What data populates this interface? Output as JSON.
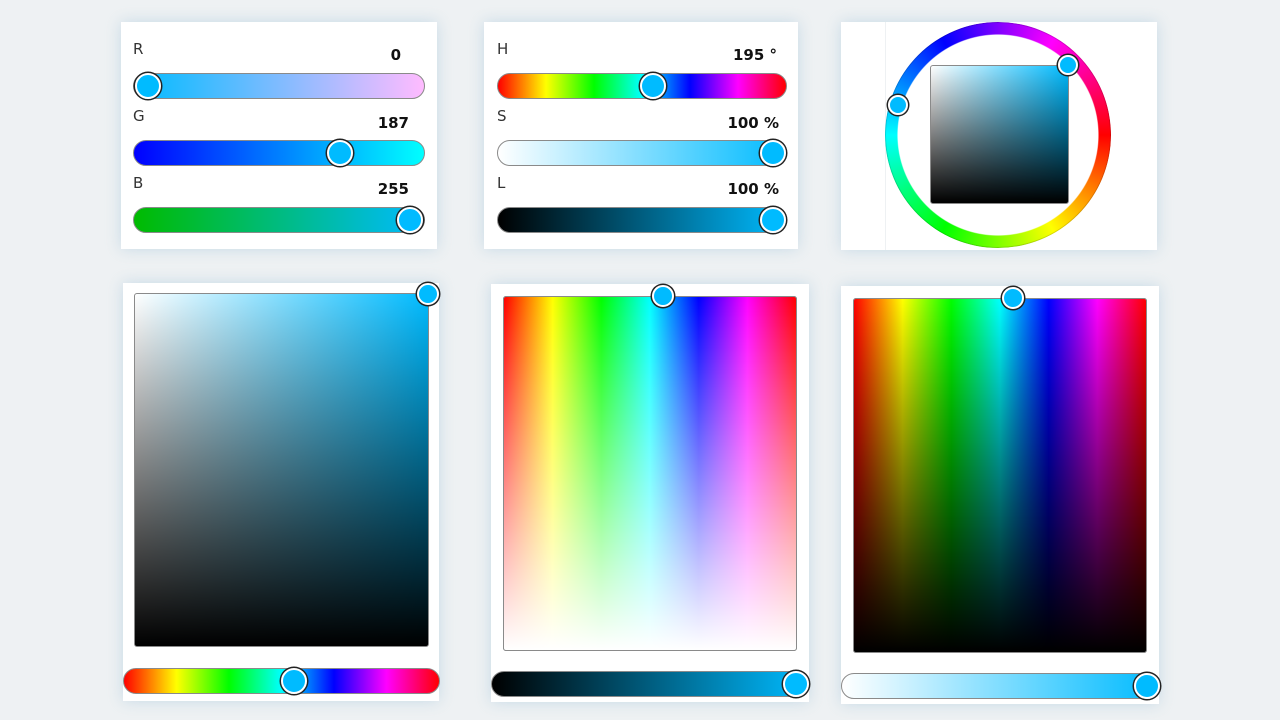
{
  "color": {
    "hex": "#00bbff",
    "accent": "#00bbff"
  },
  "rgb_panel": {
    "r": {
      "label": "R",
      "value": "0"
    },
    "g": {
      "label": "G",
      "value": "187"
    },
    "b": {
      "label": "B",
      "value": "255"
    }
  },
  "hsl_panel": {
    "h": {
      "label": "H",
      "value": "195 °"
    },
    "s": {
      "label": "S",
      "value": "100 %"
    },
    "l": {
      "label": "L",
      "value": "100 %"
    }
  },
  "levels": {
    "hue_degrees": 195,
    "saturation_percent": 100,
    "lightness_percent": 100,
    "r": 0,
    "g": 187,
    "b": 255
  }
}
